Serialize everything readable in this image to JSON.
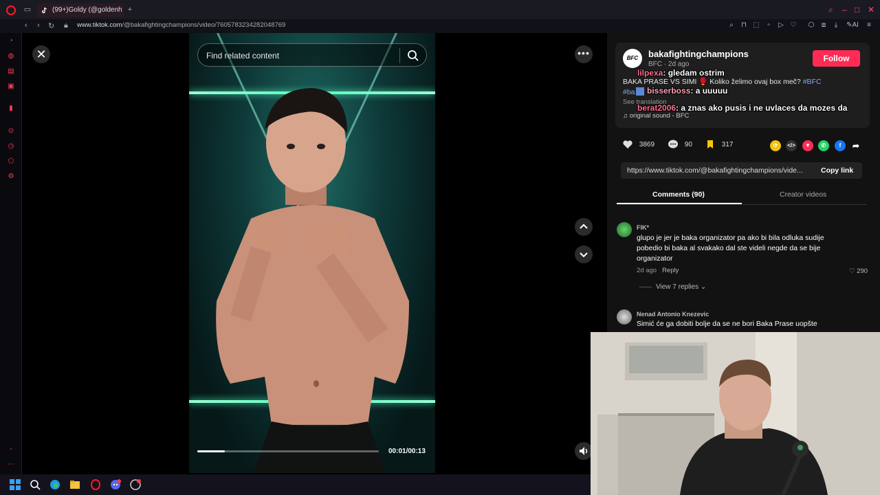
{
  "browser": {
    "tab_title": "(99+)Goldy (@goldenh",
    "url_domain": "www.tiktok.com",
    "url_path": "/@bakafightingchampions/video/7605783234282048769",
    "toolbar_right_label": "AI"
  },
  "video": {
    "search_placeholder": "Find related content",
    "time": "00:01/00:13",
    "progress": 0.15
  },
  "post": {
    "avatar_text": "BFC",
    "username": "bakafightingchampions",
    "meta": "BFC · 2d ago",
    "follow_label": "Follow",
    "description": "BAKA PRASE VS SIMI 🥊 Koliko želimo ovaj box meč? ",
    "hashtag1": "#BFC",
    "hashtag2": "#ba",
    "see_translation": "See translation",
    "sound": "original sound - BFC",
    "likes": "3869",
    "comments": "90",
    "saves": "317",
    "share_link": "https://www.tiktok.com/@bakafightingchampions/vide...",
    "copy_link_label": "Copy link"
  },
  "tabs": {
    "comments": "Comments (90)",
    "creator_videos": "Creator videos"
  },
  "comments": [
    {
      "user": "FIK*",
      "text": "glupo je jer je baka organizator pa ako bi bila odluka sudije pobedio bi baka al svakako dal ste videli negde da se bije organizator",
      "age": "2d ago",
      "reply": "Reply",
      "likes": "290",
      "view_replies": "View 7 replies"
    },
    {
      "user": "Nenad Antonio Knezevic",
      "text": "Simić će ga dobiti bolje da se ne bori Baka Prase uopšte"
    }
  ],
  "stream_chat": [
    {
      "nick": "lilpexa",
      "msg": ": gledam ostrim"
    },
    {
      "nick": "bisserboss",
      "msg": ": a uuuuu"
    },
    {
      "nick": "berat2006",
      "msg": ": a znas ako pusis i ne uvlaces da mozes da"
    }
  ],
  "colors": {
    "accent": "#fe2c55",
    "opera_red": "#ff1b2d",
    "panel_bg": "#121212"
  }
}
